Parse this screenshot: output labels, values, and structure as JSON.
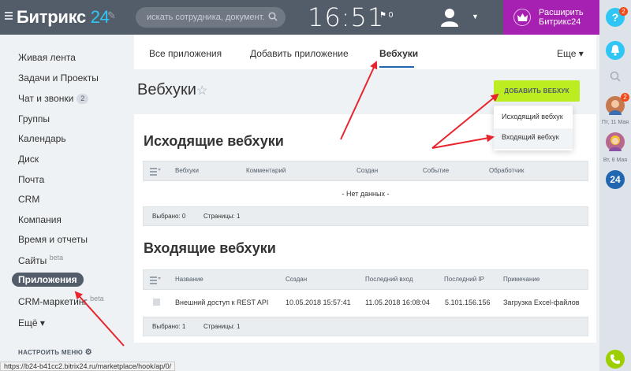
{
  "header": {
    "logo_brand": "Битрикс",
    "logo_num": "24",
    "search_placeholder": "искать сотрудника, документ...",
    "clock": "16:51",
    "flag_count": "0",
    "upgrade_label": "Расширить Битрикс24"
  },
  "rail": {
    "help_badge": "2",
    "contact1_badge": "2",
    "contact1_date": "Пт, 11 Мая",
    "contact2_date": "Вт, 8 Мая",
    "b24_label": "24"
  },
  "menu": {
    "items": [
      {
        "label": "Живая лента"
      },
      {
        "label": "Задачи и Проекты"
      },
      {
        "label": "Чат и звонки",
        "count": "2"
      },
      {
        "label": "Группы"
      },
      {
        "label": "Календарь"
      },
      {
        "label": "Диск"
      },
      {
        "label": "Почта"
      },
      {
        "label": "CRM"
      },
      {
        "label": "Компания"
      },
      {
        "label": "Время и отчеты"
      },
      {
        "label": "Сайты",
        "sup": "beta"
      },
      {
        "label": "Приложения"
      },
      {
        "label": "CRM-маркетинг",
        "sup": "beta"
      },
      {
        "label": "Ещё ▾"
      }
    ],
    "setup_label": "НАСТРОИТЬ МЕНЮ"
  },
  "status_url": "https://b24-b41cc2.bitrix24.ru/marketplace/hook/ap/0/",
  "tabs": {
    "items": [
      "Все приложения",
      "Добавить приложение",
      "Вебхуки"
    ],
    "more": "Еще ▾"
  },
  "page": {
    "title": "Вебхуки",
    "add_button": "ДОБАВИТЬ ВЕБХУК",
    "dropdown": [
      "Исходящий вебхук",
      "Входящий вебхук"
    ]
  },
  "outgoing": {
    "title": "Исходящие вебхуки",
    "columns": [
      "Вебхуки",
      "Комментарий",
      "Создан",
      "Событие",
      "Обработчик"
    ],
    "empty": "- Нет данных -",
    "selected": "Выбрано: 0",
    "pages": "Страницы: 1"
  },
  "incoming": {
    "title": "Входящие вебхуки",
    "columns": [
      "Название",
      "Создан",
      "Последний вход",
      "Последний IP",
      "Примечание"
    ],
    "rows": [
      [
        "Внешний доступ к REST API",
        "10.05.2018 15:57:41",
        "11.05.2018 16:08:04",
        "5.101.156.156",
        "Загрузка Excel-файлов"
      ]
    ],
    "selected": "Выбрано: 1",
    "pages": "Страницы: 1"
  },
  "colors": {
    "header_bg": "#535c69",
    "accent_purple": "#a620b2",
    "accent_green": "#bbed21",
    "accent_blue": "#2fc6f6",
    "annotation_red": "#e8252e"
  }
}
